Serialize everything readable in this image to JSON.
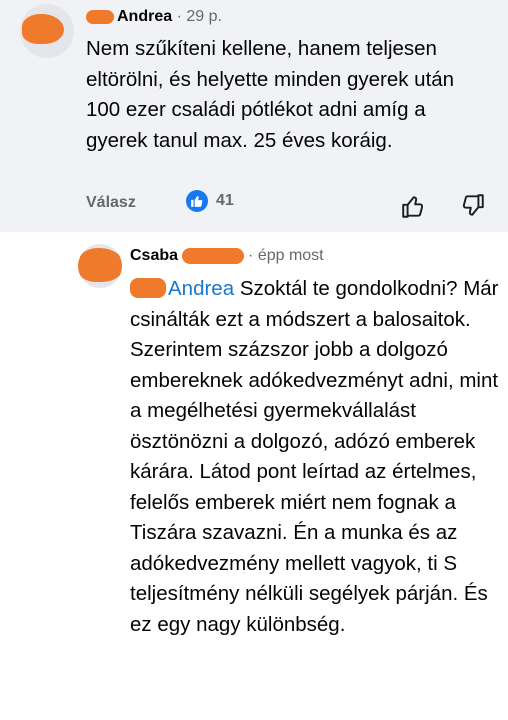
{
  "first_comment": {
    "author": "Andrea",
    "time": "29 p.",
    "text": "Nem szűkíteni kellene, hanem teljesen eltörölni, és helyette minden gyerek után 100 ezer családi pótlékot adni amíg a gyerek tanul max. 25 éves koráig.",
    "reply_label": "Válasz",
    "like_count": "41",
    "icons": [
      "like-badge-icon",
      "thumbs-up-icon",
      "thumbs-down-icon"
    ]
  },
  "reply": {
    "author": "Csaba",
    "time": "épp most",
    "mention": "Andrea",
    "text": "Szoktál te gondolkodni? Már csinálták ezt a módszert a balosaitok. Szerintem százszor jobb a dolgozó embereknek adókedvezményt adni, mint a megélhetési gyermekvállalást ösztönözni a dolgozó, adózó emberek kárára. Látod pont leírtad az értelmes, felelős emberek miért nem fognak a Tiszára szavazni. Én a munka és az adókedvezmény mellett vagyok, ti S teljesítmény nélküli segélyek párján. És ez egy nagy különbség."
  },
  "colors": {
    "top_background": "#f0f2f5",
    "mention": "#1876d2",
    "redaction": "#f07a2c",
    "like_badge": "#1877f2",
    "meta_text": "#65676b"
  }
}
